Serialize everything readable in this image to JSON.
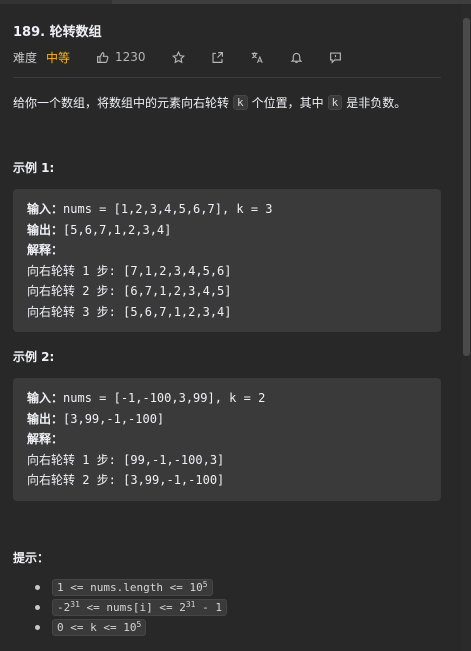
{
  "problem": {
    "title": "189. 轮转数组",
    "difficulty_label": "难度",
    "difficulty": "中等",
    "likes": "1230",
    "difficulty_color": "#ffb800"
  },
  "icons": [
    "thumbs-up-icon",
    "star-icon",
    "share-icon",
    "translate-icon",
    "bell-icon",
    "feedback-icon"
  ],
  "description": {
    "before": "给你一个数组，将数组中的元素向右轮转",
    "k1": "k",
    "middle": "个位置，其中",
    "k2": "k",
    "after": "是非负数。"
  },
  "examples": [
    {
      "title": "示例 1:",
      "input_label": "输入：",
      "input": "nums = [1,2,3,4,5,6,7], k = 3",
      "output_label": "输出：",
      "output": "[5,6,7,1,2,3,4]",
      "explain_label": "解释：",
      "steps": [
        "向右轮转 1 步: [7,1,2,3,4,5,6]",
        "向右轮转 2 步: [6,7,1,2,3,4,5]",
        "向右轮转 3 步: [5,6,7,1,2,3,4]"
      ]
    },
    {
      "title": "示例 2:",
      "input_label": "输入：",
      "input": "nums = [-1,-100,3,99], k = 2",
      "output_label": "输出：",
      "output": "[3,99,-1,-100]",
      "explain_label": "解释：",
      "steps": [
        "向右轮转 1 步: [99,-1,-100,3]",
        "向右轮转 2 步: [3,99,-1,-100]"
      ]
    }
  ],
  "hints": {
    "title": "提示：",
    "h1_pre": "1 <= nums.length <= 10",
    "h1_sup": "5",
    "h2_pre": "-2",
    "h2_sup1": "31",
    "h2_mid": " <= nums[i] <= 2",
    "h2_sup2": "31",
    "h2_post": " - 1",
    "h3_pre": "0 <= k <= 10",
    "h3_sup": "5"
  }
}
